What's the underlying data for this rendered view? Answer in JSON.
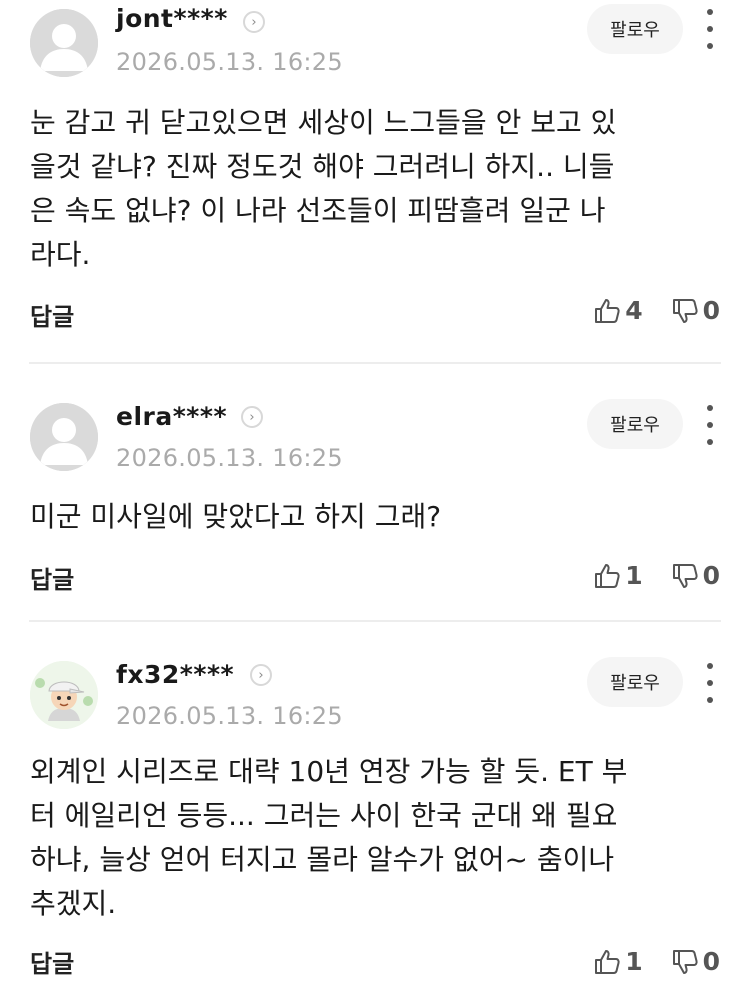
{
  "comments": [
    {
      "username": "jont****",
      "timestamp": "2026.05.13. 16:25",
      "follow_label": "팔로우",
      "avatar": "default-avatar",
      "body": "눈 감고 귀 닫고있으면 세상이 느그들을 안 보고 있\n을것 같냐? 진짜 정도것 해야 그러려니 하지.. 니들\n은 속도 없냐? 이 나라 선조들이 피땀흘려 일군 나\n라다.",
      "reply_label": "답글",
      "likes": "4",
      "dislikes": "0"
    },
    {
      "username": "elra****",
      "timestamp": "2026.05.13. 16:25",
      "follow_label": "팔로우",
      "avatar": "default-avatar",
      "body": "미군 미사일에 맞았다고 하지 그래?",
      "reply_label": "답글",
      "likes": "1",
      "dislikes": "0"
    },
    {
      "username": "fx32****",
      "timestamp": "2026.05.13. 16:25",
      "follow_label": "팔로우",
      "avatar": "cartoon-avatar",
      "body": "외계인 시리즈로 대략 10년 연장 가능 할 듯. ET 부\n터 에일리언 등등... 그러는 사이 한국 군대 왜 필요\n하냐, 늘상 얻어 터지고 몰라 알수가 없어~ 춤이나\n추겠지.",
      "reply_label": "답글",
      "likes": "1",
      "dislikes": "0"
    }
  ],
  "icons": {
    "chevron": "chevron-right-icon",
    "more": "more-vertical-icon",
    "like": "thumbs-up-icon",
    "dislike": "thumbs-down-icon"
  }
}
